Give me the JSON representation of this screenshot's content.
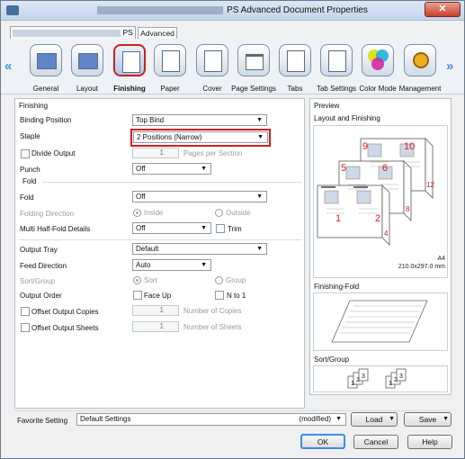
{
  "window": {
    "title": "PS Advanced Document Properties",
    "close_label": "✕"
  },
  "tabs": [
    {
      "label": "PS"
    },
    {
      "label": "Advanced"
    }
  ],
  "categories": [
    {
      "label": "General",
      "icon": "printer-general-icon"
    },
    {
      "label": "Layout",
      "icon": "layout-icon"
    },
    {
      "label": "Finishing",
      "icon": "finishing-icon",
      "active": true
    },
    {
      "label": "Paper",
      "icon": "paper-icon"
    },
    {
      "label": "Cover",
      "icon": "cover-icon"
    },
    {
      "label": "Page Settings",
      "icon": "page-settings-icon"
    },
    {
      "label": "Tabs",
      "icon": "tabs-icon"
    },
    {
      "label": "Tab Settings",
      "icon": "tab-settings-icon"
    },
    {
      "label": "Color Mode",
      "icon": "color-mode-icon"
    },
    {
      "label": "Management",
      "icon": "management-icon"
    }
  ],
  "finishing": {
    "section_title": "Finishing",
    "binding_position_label": "Binding Position",
    "binding_position_value": "Top Bind",
    "staple_label": "Staple",
    "staple_value": "2 Positions (Narrow)",
    "divide_output_label": "Divide Output",
    "divide_output_count": "1",
    "pages_per_section_label": "Pages per Section",
    "punch_label": "Punch",
    "punch_value": "Off",
    "fold_section": "Fold",
    "fold_label": "Fold",
    "fold_value": "Off",
    "folding_direction_label": "Folding Direction",
    "inside_label": "Inside",
    "outside_label": "Outside",
    "multi_half_fold_label": "Multi Half-Fold Details",
    "multi_half_fold_value": "Off",
    "trim_label": "Trim",
    "output_tray_label": "Output Tray",
    "output_tray_value": "Default",
    "feed_direction_label": "Feed Direction",
    "feed_direction_value": "Auto",
    "sort_group_label": "Sort/Group",
    "sort_label": "Sort",
    "group_label": "Group",
    "output_order_label": "Output Order",
    "face_up_label": "Face Up",
    "n_to_1_label": "N to 1",
    "offset_copies_label": "Offset Output Copies",
    "offset_copies_value": "1",
    "number_of_copies_label": "Number of Copies",
    "offset_sheets_label": "Offset Output Sheets",
    "offset_sheets_value": "1",
    "number_of_sheets_label": "Number of Sheets"
  },
  "preview": {
    "title": "Preview",
    "layout_title": "Layout and Finishing",
    "page_numbers": [
      "1",
      "2",
      "4",
      "5",
      "6",
      "8",
      "9",
      "10",
      "12"
    ],
    "paper_name": "A4",
    "paper_size": "210.0x297.0 mm",
    "finishing_fold_title": "Finishing-Fold",
    "sort_group_title": "Sort/Group",
    "sort_stack_a": [
      "1",
      "2",
      "3"
    ],
    "sort_stack_b": [
      "1",
      "2",
      "3"
    ]
  },
  "footer": {
    "favorite_label": "Favorite Setting",
    "favorite_value": "Default Settings",
    "modified_label": "(modified)",
    "load_label": "Load",
    "save_label": "Save",
    "ok_label": "OK",
    "cancel_label": "Cancel",
    "help_label": "Help"
  },
  "colors": {
    "highlight": "#d0201c",
    "accent": "#3b8de0"
  }
}
